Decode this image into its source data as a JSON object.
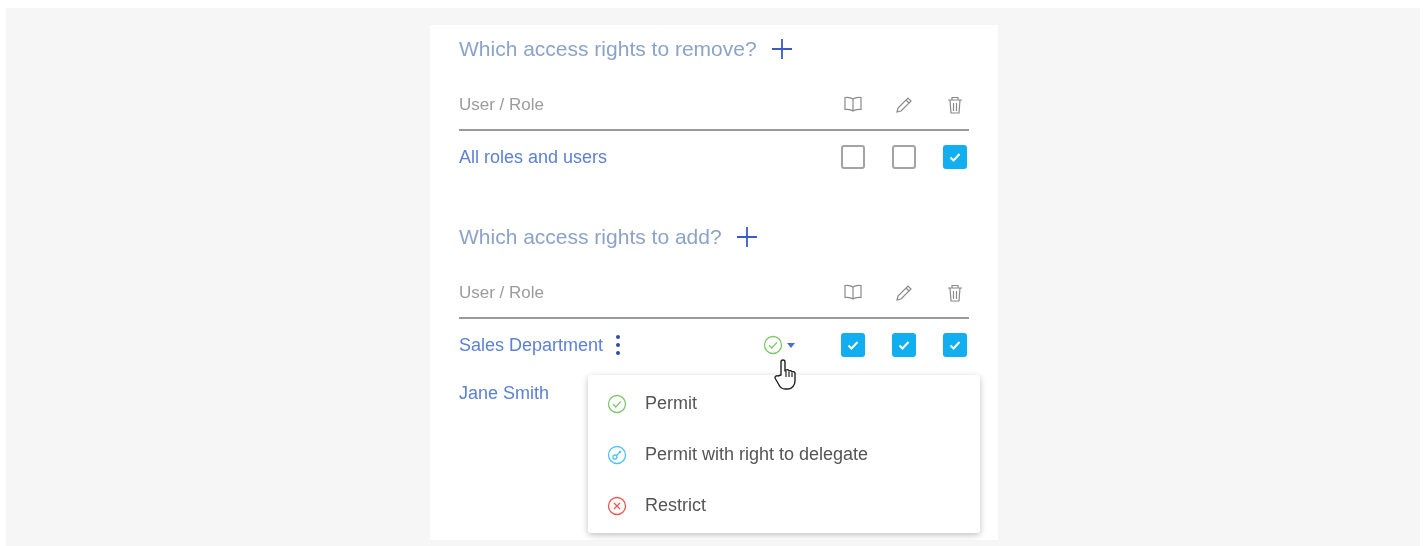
{
  "sections": [
    {
      "title": "Which access rights to remove?",
      "column_header": "User / Role",
      "rows": [
        {
          "name": "All roles and users",
          "has_menu": false,
          "checks": [
            false,
            false,
            true
          ]
        }
      ]
    },
    {
      "title": "Which access rights to add?",
      "column_header": "User / Role",
      "rows": [
        {
          "name": "Sales Department",
          "has_menu": true,
          "permitted": true,
          "checks": [
            true,
            true,
            true
          ]
        },
        {
          "name": "Jane Smith",
          "has_menu": false
        }
      ]
    }
  ],
  "dropdown": {
    "items": [
      {
        "kind": "permit",
        "label": "Permit"
      },
      {
        "kind": "delegate",
        "label": "Permit with right to delegate"
      },
      {
        "kind": "restrict",
        "label": "Restrict"
      }
    ]
  }
}
